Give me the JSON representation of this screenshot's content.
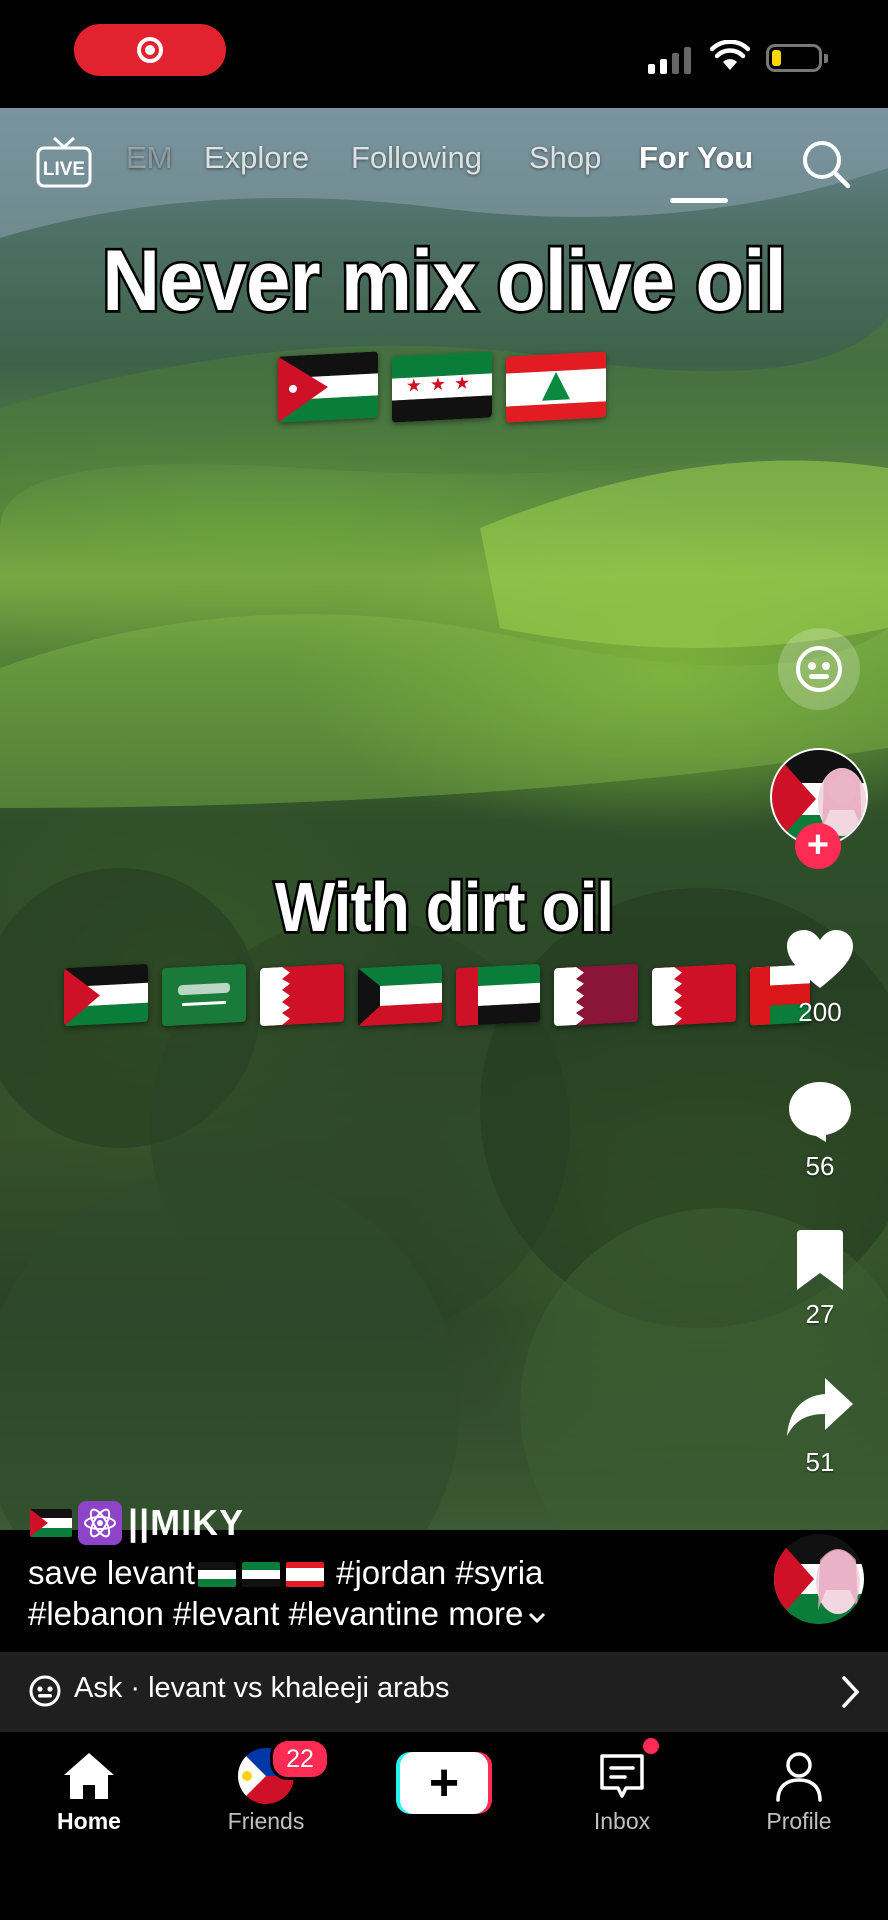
{
  "status_bar": {
    "recording_icon": "screen-record-icon",
    "signal_icon": "cellular-signal-icon",
    "wifi_icon": "wifi-icon",
    "battery_icon": "battery-icon",
    "battery_color": "#ffd60a",
    "battery_level": 0.15
  },
  "top_nav": {
    "live_icon": "live-tv-icon",
    "live_label": "LIVE",
    "tabs": [
      {
        "label": "EM",
        "state": "faded"
      },
      {
        "label": "Explore",
        "state": "normal"
      },
      {
        "label": "Following",
        "state": "normal"
      },
      {
        "label": "Shop",
        "state": "normal"
      },
      {
        "label": "For You",
        "state": "active"
      }
    ],
    "search_icon": "search-icon"
  },
  "video": {
    "caption_top": "Never mix olive oil",
    "flags_top": [
      "Jordan",
      "Syria",
      "Lebanon"
    ],
    "caption_middle": "With dirt oil",
    "flags_middle": [
      "Palestine",
      "Saudi Arabia",
      "Bahrain",
      "Kuwait",
      "UAE",
      "Qatar",
      "Bahrain",
      "Oman"
    ]
  },
  "right_rail": {
    "ai_face_icon": "ai-face-icon",
    "follow_icon": "plus-icon",
    "likes": "200",
    "comments": "56",
    "bookmarks": "27",
    "shares": "51"
  },
  "post": {
    "author": "||MIKY",
    "description_start": "save levant",
    "hashtags_line1": "#jordan #syria",
    "hashtags_line2": "#lebanon #levant #levantine",
    "more_label": "more"
  },
  "ask_bar": {
    "text": "Ask · levant vs khaleeji arabs"
  },
  "bottom_nav": {
    "items": [
      {
        "label": "Home",
        "icon": "home-icon",
        "active": true
      },
      {
        "label": "Friends",
        "icon": "friends-avatar",
        "active": false
      },
      {
        "label": "",
        "icon": "create-plus-icon",
        "active": false
      },
      {
        "label": "Inbox",
        "icon": "inbox-icon",
        "active": false
      },
      {
        "label": "Profile",
        "icon": "profile-icon",
        "active": false
      }
    ],
    "friends_badge": "22",
    "create_symbol": "+"
  },
  "colors": {
    "accent_red": "#fe2c55",
    "accent_cyan": "#25f4ee",
    "record_red": "#e3222f"
  }
}
